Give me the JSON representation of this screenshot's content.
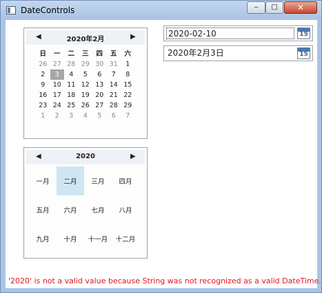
{
  "window": {
    "title": "DateControls",
    "minimize_glyph": "‒",
    "maximize_glyph": "□",
    "close_glyph": "✕"
  },
  "calendar": {
    "title": "2020年2月",
    "prev_glyph": "◀",
    "next_glyph": "▶",
    "day_names": [
      "日",
      "一",
      "二",
      "三",
      "四",
      "五",
      "六"
    ],
    "weeks": [
      [
        "26",
        "27",
        "28",
        "29",
        "30",
        "31",
        "1"
      ],
      [
        "2",
        "3",
        "4",
        "5",
        "6",
        "7",
        "8"
      ],
      [
        "9",
        "10",
        "11",
        "12",
        "13",
        "14",
        "15"
      ],
      [
        "16",
        "17",
        "18",
        "19",
        "20",
        "21",
        "22"
      ],
      [
        "23",
        "24",
        "25",
        "26",
        "27",
        "28",
        "29"
      ],
      [
        "1",
        "2",
        "3",
        "4",
        "5",
        "6",
        "7"
      ]
    ],
    "selected_day": "3"
  },
  "month_calendar": {
    "title": "2020",
    "prev_glyph": "◀",
    "next_glyph": "▶",
    "months": [
      "一月",
      "二月",
      "三月",
      "四月",
      "五月",
      "六月",
      "七月",
      "八月",
      "九月",
      "十月",
      "十一月",
      "十二月"
    ],
    "selected_month": "二月"
  },
  "date_picker_1": {
    "value": "2020-02-10",
    "icon_day": "15"
  },
  "date_picker_2": {
    "value": "2020年2月3日",
    "icon_day": "15"
  },
  "error": {
    "message": "'2020' is not a valid value because String was not recognized as a valid DateTime.",
    "color": "#e0141e"
  }
}
